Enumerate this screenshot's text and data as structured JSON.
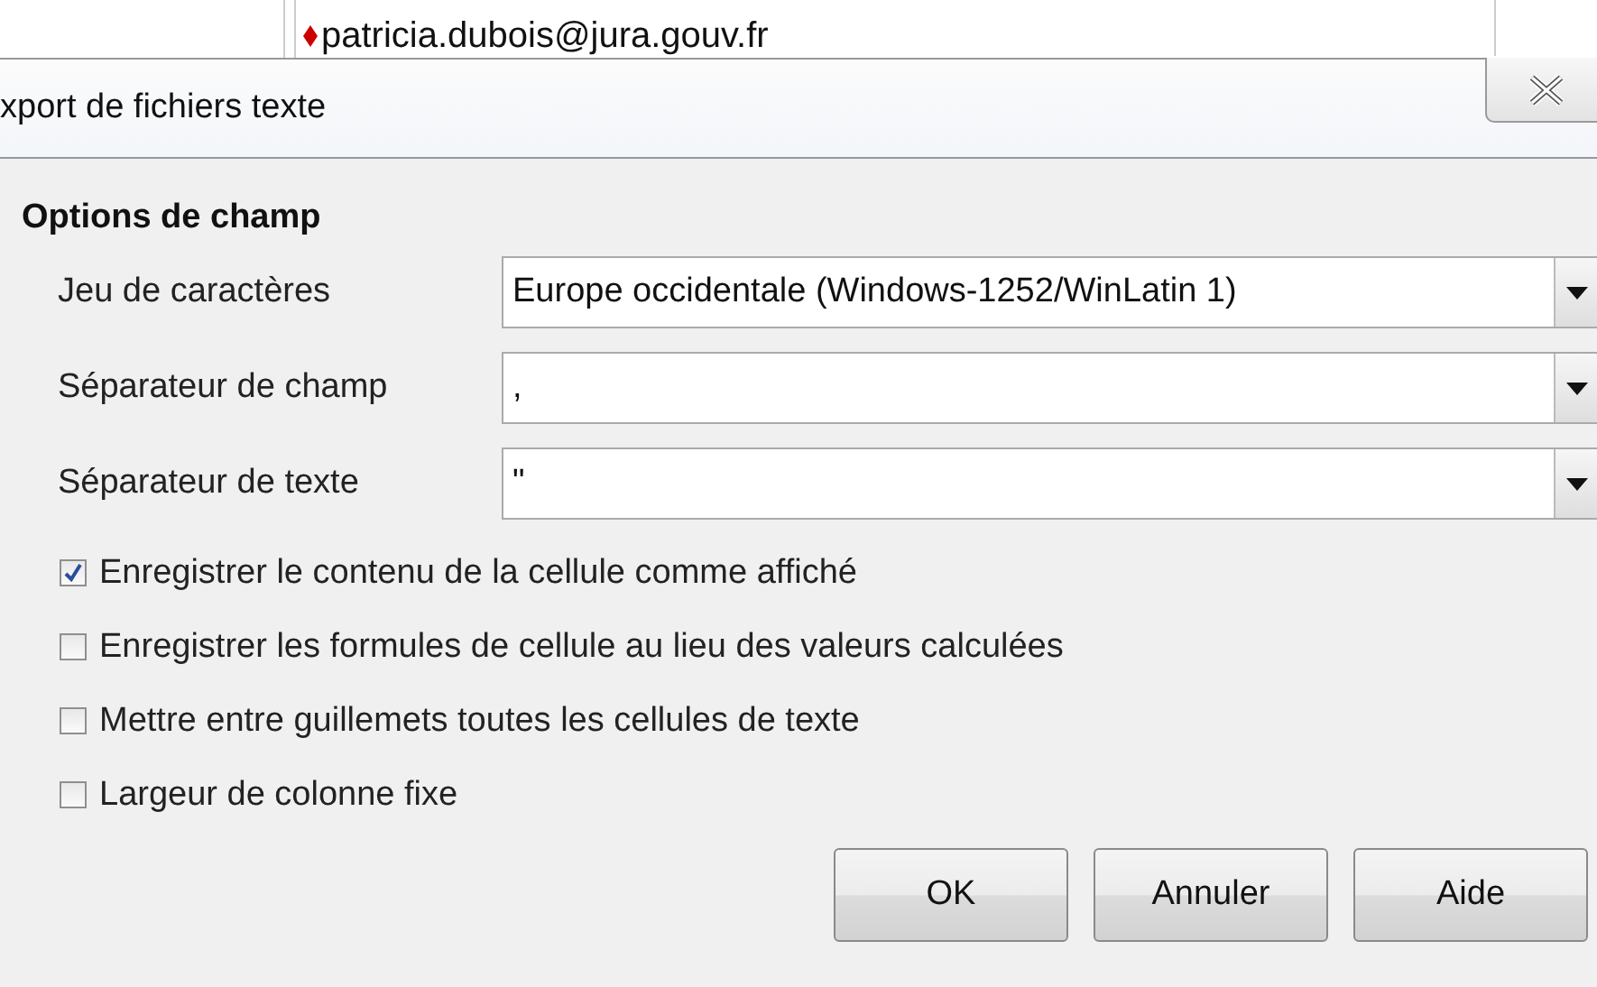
{
  "background_sheet": {
    "cell_text": "patricia.dubois@jura.gouv.fr"
  },
  "window": {
    "title": "xport de fichiers texte"
  },
  "section": {
    "title": "Options de champ",
    "fields": [
      {
        "label": "Jeu de caractères",
        "value": "Europe occidentale (Windows-1252/WinLatin 1)"
      },
      {
        "label": "Séparateur de champ",
        "value": ","
      },
      {
        "label": "Séparateur de texte",
        "value": "\""
      }
    ],
    "options": [
      {
        "label": "Enregistrer le contenu de la cellule comme affiché",
        "checked": true
      },
      {
        "label": "Enregistrer les formules de cellule au lieu des valeurs calculées",
        "checked": false
      },
      {
        "label": "Mettre entre guillemets toutes les cellules de texte",
        "checked": false
      },
      {
        "label": "Largeur de colonne fixe",
        "checked": false
      }
    ]
  },
  "buttons": [
    "OK",
    "Annuler",
    "Aide"
  ]
}
